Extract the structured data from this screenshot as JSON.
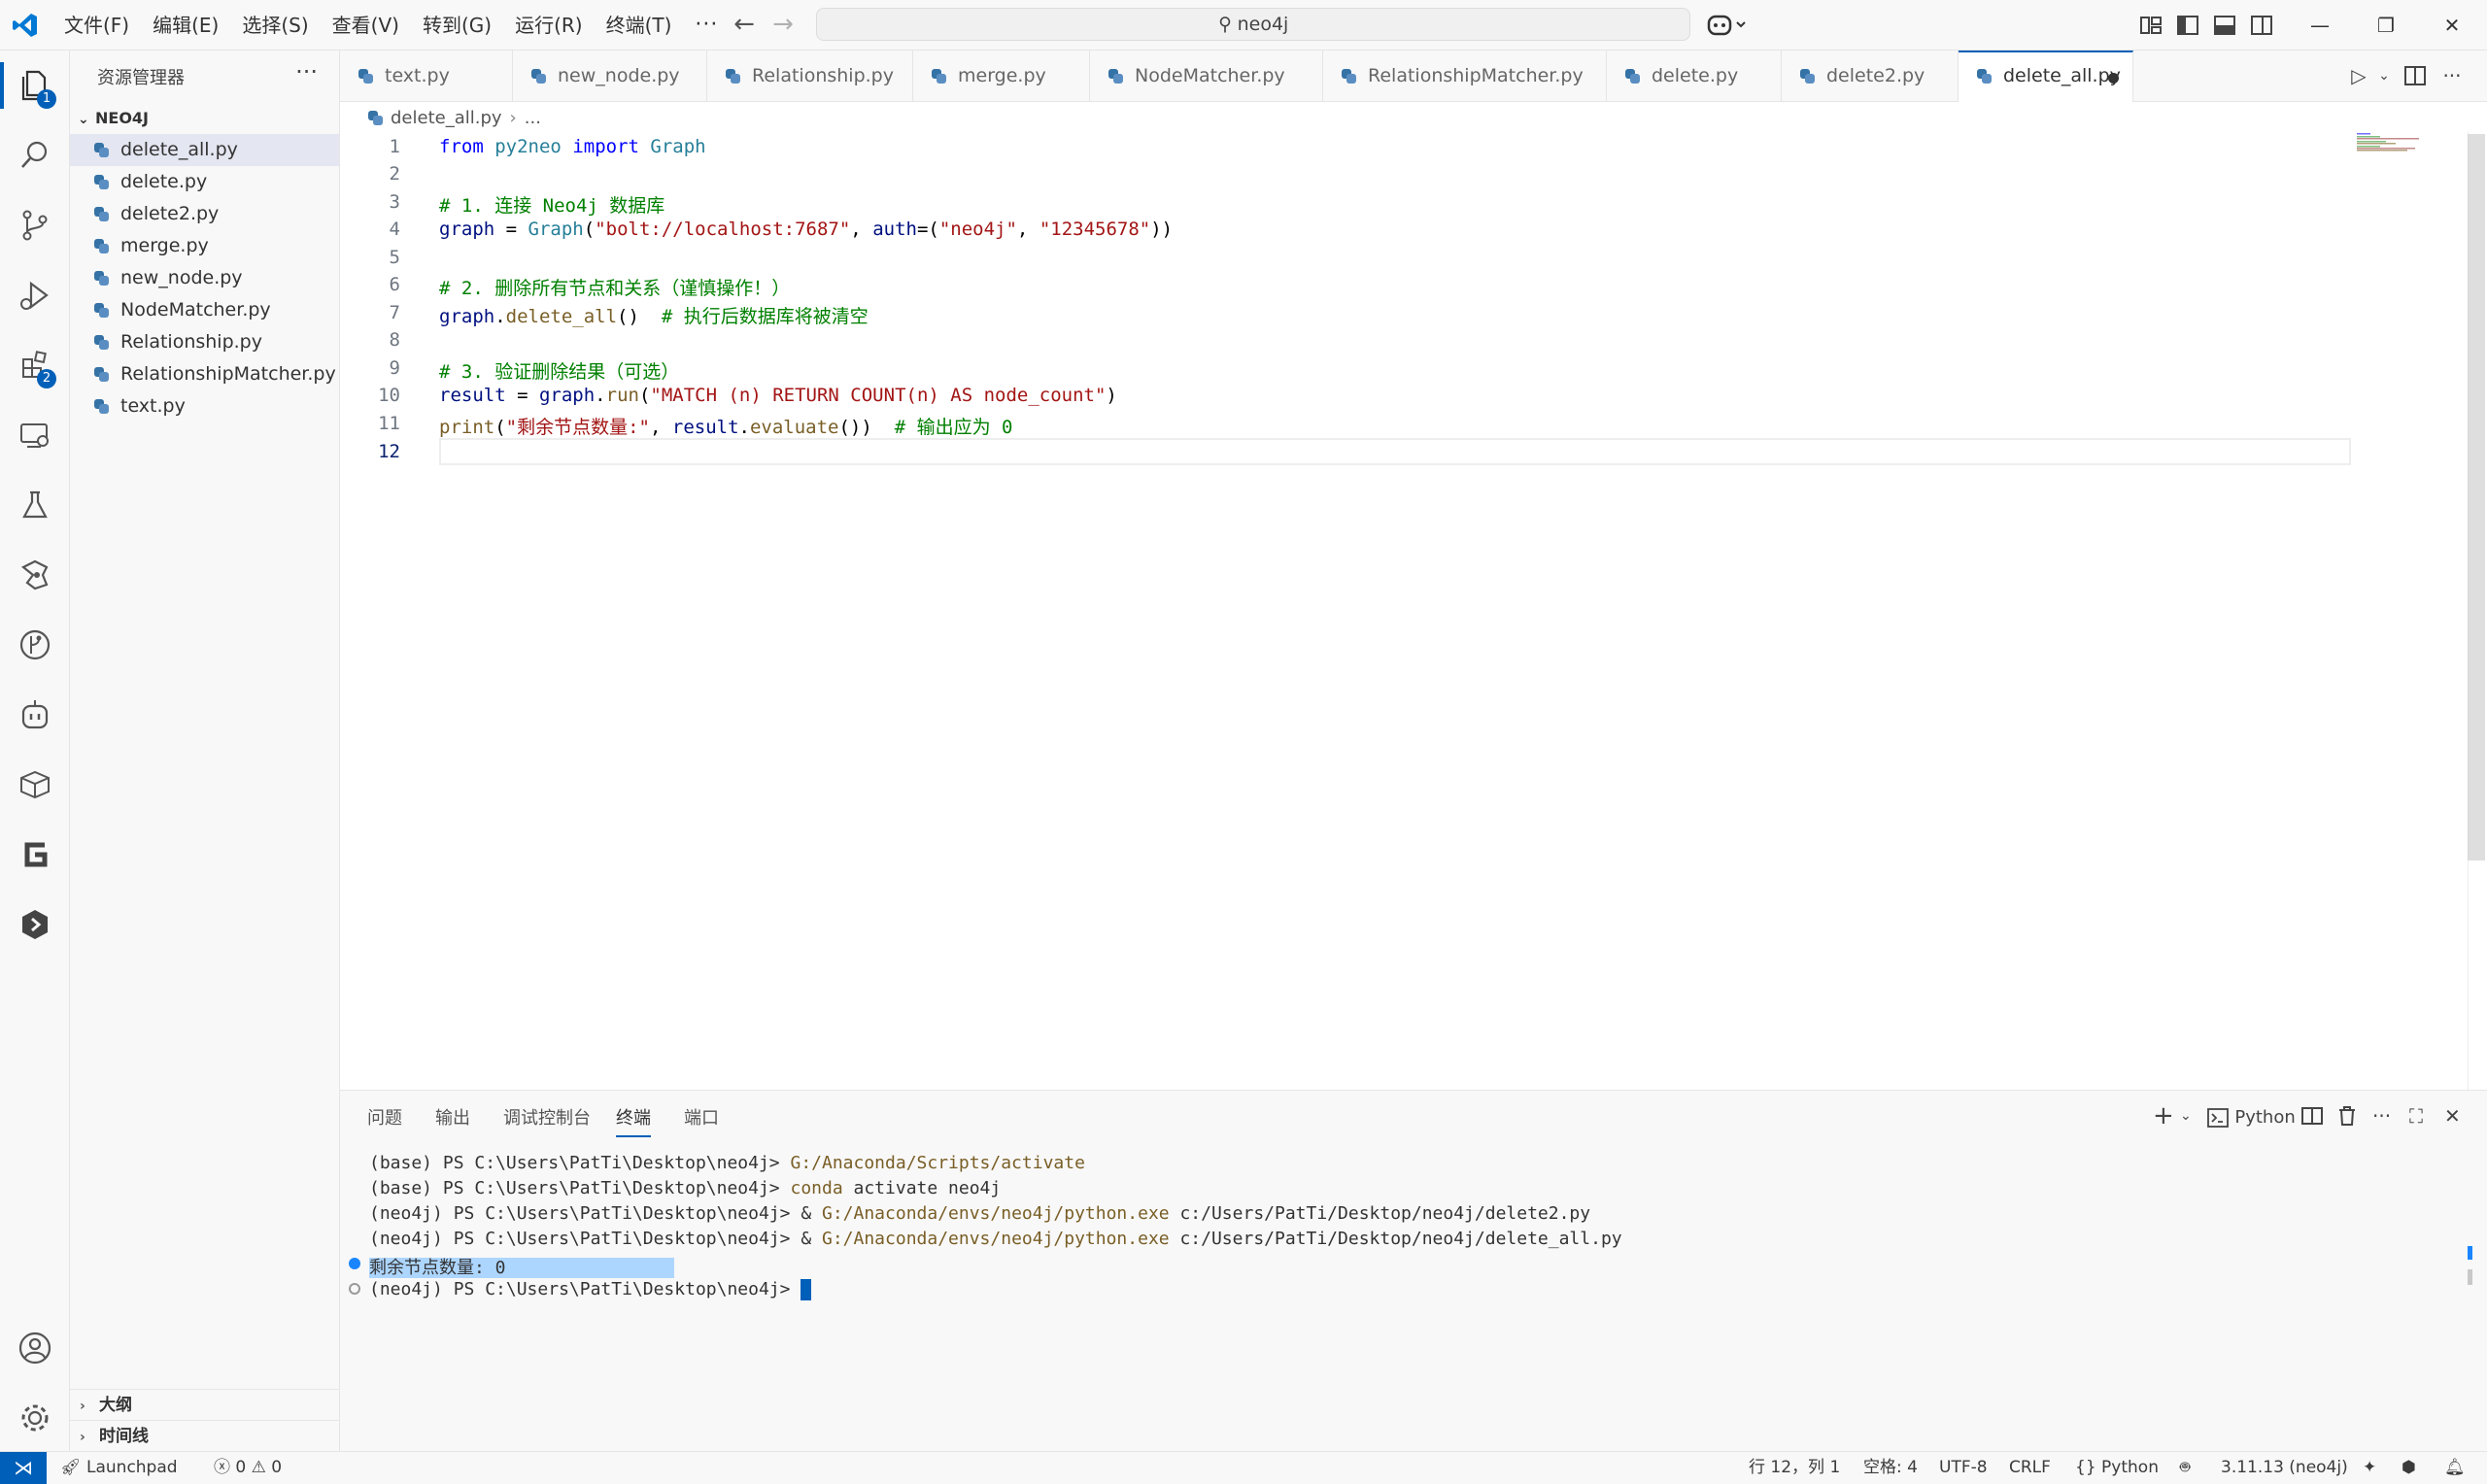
{
  "menu": [
    "文件(F)",
    "编辑(E)",
    "选择(S)",
    "查看(V)",
    "转到(G)",
    "运行(R)",
    "终端(T)"
  ],
  "menu_more": "···",
  "search": {
    "text": "neo4j"
  },
  "activity_badges": {
    "explorer": "1",
    "extensions": "2"
  },
  "sidebar": {
    "title": "资源管理器",
    "more": "···",
    "folder": "NEO4J",
    "files": [
      "delete_all.py",
      "delete.py",
      "delete2.py",
      "merge.py",
      "new_node.py",
      "NodeMatcher.py",
      "Relationship.py",
      "RelationshipMatcher.py",
      "text.py"
    ],
    "sections": [
      "大纲",
      "时间线"
    ]
  },
  "tabs": [
    "text.py",
    "new_node.py",
    "Relationship.py",
    "merge.py",
    "NodeMatcher.py",
    "RelationshipMatcher.py",
    "delete.py",
    "delete2.py",
    "delete_all.py"
  ],
  "breadcrumb": {
    "file": "delete_all.py",
    "rest": "..."
  },
  "editor": {
    "line_numbers": [
      "1",
      "2",
      "3",
      "4",
      "5",
      "6",
      "7",
      "8",
      "9",
      "10",
      "11",
      "12"
    ],
    "code": {
      "l1": {
        "kw1": "from",
        "mod": "py2neo",
        "kw2": "import",
        "cls": "Graph"
      },
      "l3": "# 1. 连接 Neo4j 数据库",
      "l4": {
        "var": "graph",
        "op": " = ",
        "cls": "Graph",
        "p1": "(",
        "s1": "\"bolt://localhost:7687\"",
        "c1": ", ",
        "arg": "auth",
        "eq": "=(",
        "s2": "\"neo4j\"",
        "c2": ", ",
        "s3": "\"12345678\"",
        "p2": "))"
      },
      "l6": "# 2. 删除所有节点和关系（谨慎操作！）",
      "l7": {
        "var": "graph",
        "dot": ".",
        "fn": "delete_all",
        "paren": "()",
        "cm": "  # 执行后数据库将被清空"
      },
      "l9": "# 3. 验证删除结果（可选）",
      "l10": {
        "var1": "result",
        "op": " = ",
        "var2": "graph",
        "dot": ".",
        "fn": "run",
        "p1": "(",
        "st": "\"MATCH (n) RETURN COUNT(n) AS node_count\"",
        "p2": ")"
      },
      "l11": {
        "bi": "print",
        "p1": "(",
        "st": "\"剩余节点数量:\"",
        "c": ", ",
        "var": "result",
        "dot": ".",
        "fn": "evaluate",
        "p2": "())",
        "cm": "  # 输出应为 0"
      }
    }
  },
  "panel": {
    "tabs": [
      "问题",
      "输出",
      "调试控制台",
      "终端",
      "端口"
    ],
    "shell": "Python",
    "terminal": [
      {
        "prompt": "(base) PS C:\\Users\\PatTi\\Desktop\\neo4j> ",
        "cmd": "G:/Anaconda/Scripts/activate",
        "rest": ""
      },
      {
        "prompt": "(base) PS C:\\Users\\PatTi\\Desktop\\neo4j> ",
        "cmd": "conda",
        "rest": " activate neo4j"
      },
      {
        "prompt": "(neo4j) PS C:\\Users\\PatTi\\Desktop\\neo4j> & ",
        "cmd": "G:/Anaconda/envs/neo4j/python.exe",
        "rest": " c:/Users/PatTi/Desktop/neo4j/delete2.py"
      },
      {
        "prompt": "(neo4j) PS C:\\Users\\PatTi\\Desktop\\neo4j> & ",
        "cmd": "G:/Anaconda/envs/neo4j/python.exe",
        "rest": " c:/Users/PatTi/Desktop/neo4j/delete_all.py"
      }
    ],
    "output": "剩余节点数量: 0",
    "last_prompt": "(neo4j) PS C:\\Users\\PatTi\\Desktop\\neo4j> "
  },
  "status": {
    "remote": "Launchpad",
    "errors": "0",
    "warnings": "0",
    "position": "行 12，列 1",
    "spaces": "空格: 4",
    "encoding": "UTF-8",
    "eol": "CRLF",
    "language": "Python",
    "interpreter": "3.11.13 (neo4j)"
  },
  "colors": {
    "accent": "#005fb8",
    "keyword": "#0000ff",
    "comment": "#008000",
    "string": "#a31515"
  }
}
